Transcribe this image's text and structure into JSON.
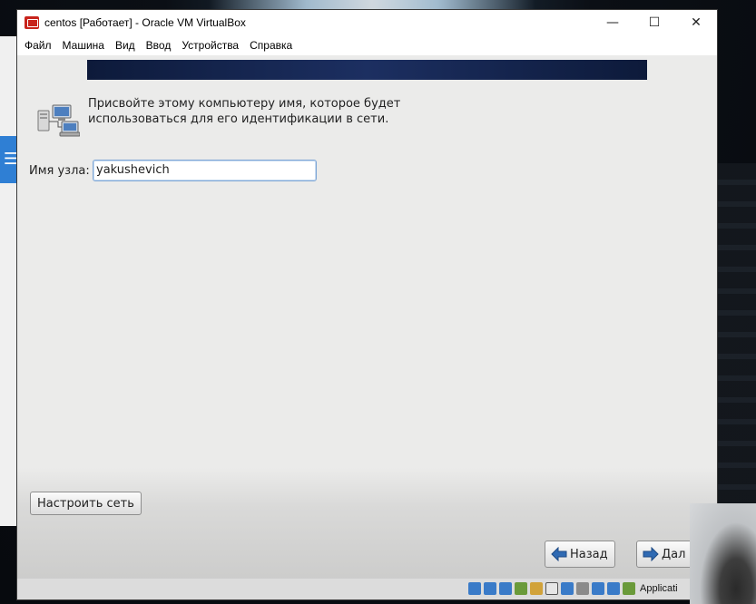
{
  "window": {
    "title": "centos [Работает] - Oracle VM VirtualBox",
    "controls": {
      "minimize": "—",
      "maximize": "☐",
      "close": "✕"
    }
  },
  "menu": [
    "Файл",
    "Машина",
    "Вид",
    "Ввод",
    "Устройства",
    "Справка"
  ],
  "installer": {
    "description": "Присвойте этому компьютеру имя, которое будет использоваться для его идентификации в сети.",
    "hostname_label": "Имя узла:",
    "hostname_value": "yakushevich",
    "configure_network_label": "Настроить сеть",
    "back_label": "Назад",
    "next_label": "Дал"
  },
  "statusbar": {
    "text": "Applicati"
  },
  "colors": {
    "banner": "#1c2f61",
    "input_border": "#7fa7d6",
    "arrow": "#2f6ab3"
  }
}
